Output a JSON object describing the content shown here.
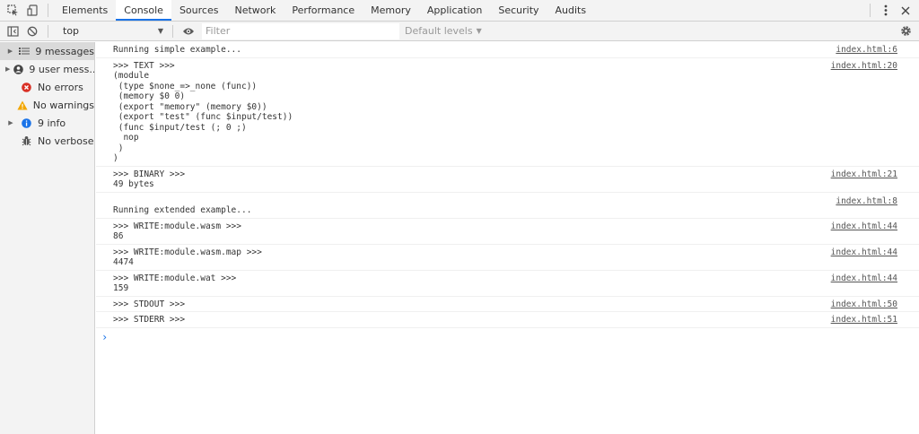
{
  "tabs": [
    "Elements",
    "Console",
    "Sources",
    "Network",
    "Performance",
    "Memory",
    "Application",
    "Security",
    "Audits"
  ],
  "toolbar": {
    "context": "top",
    "filter_placeholder": "Filter",
    "levels": "Default levels"
  },
  "sidebar": {
    "items": [
      {
        "label": "9 messages",
        "icon": "list-icon"
      },
      {
        "label": "9 user mess...",
        "icon": "user-icon"
      },
      {
        "label": "No errors",
        "icon": "error-icon"
      },
      {
        "label": "No warnings",
        "icon": "warning-icon"
      },
      {
        "label": "9 info",
        "icon": "info-icon"
      },
      {
        "label": "No verbose",
        "icon": "bug-icon"
      }
    ]
  },
  "messages": [
    {
      "text": "Running simple example...",
      "source": "index.html:6"
    },
    {
      "text": ">>> TEXT >>>\n(module\n (type $none_=>_none (func))\n (memory $0 0)\n (export \"memory\" (memory $0))\n (export \"test\" (func $input/test))\n (func $input/test (; 0 ;)\n  nop\n )\n)",
      "source": "index.html:20"
    },
    {
      "text": ">>> BINARY >>>\n49 bytes",
      "source": "index.html:21"
    },
    {
      "text": "\nRunning extended example...",
      "source": "index.html:8"
    },
    {
      "text": ">>> WRITE:module.wasm >>>\n86",
      "source": "index.html:44"
    },
    {
      "text": ">>> WRITE:module.wasm.map >>>\n4474",
      "source": "index.html:44"
    },
    {
      "text": ">>> WRITE:module.wat >>>\n159",
      "source": "index.html:44"
    },
    {
      "text": ">>> STDOUT >>>",
      "source": "index.html:50"
    },
    {
      "text": ">>> STDERR >>>",
      "source": "index.html:51"
    }
  ],
  "colors": {
    "accent": "#1a73e8",
    "error": "#d93025",
    "warning": "#f2a600",
    "info": "#1a73e8"
  }
}
